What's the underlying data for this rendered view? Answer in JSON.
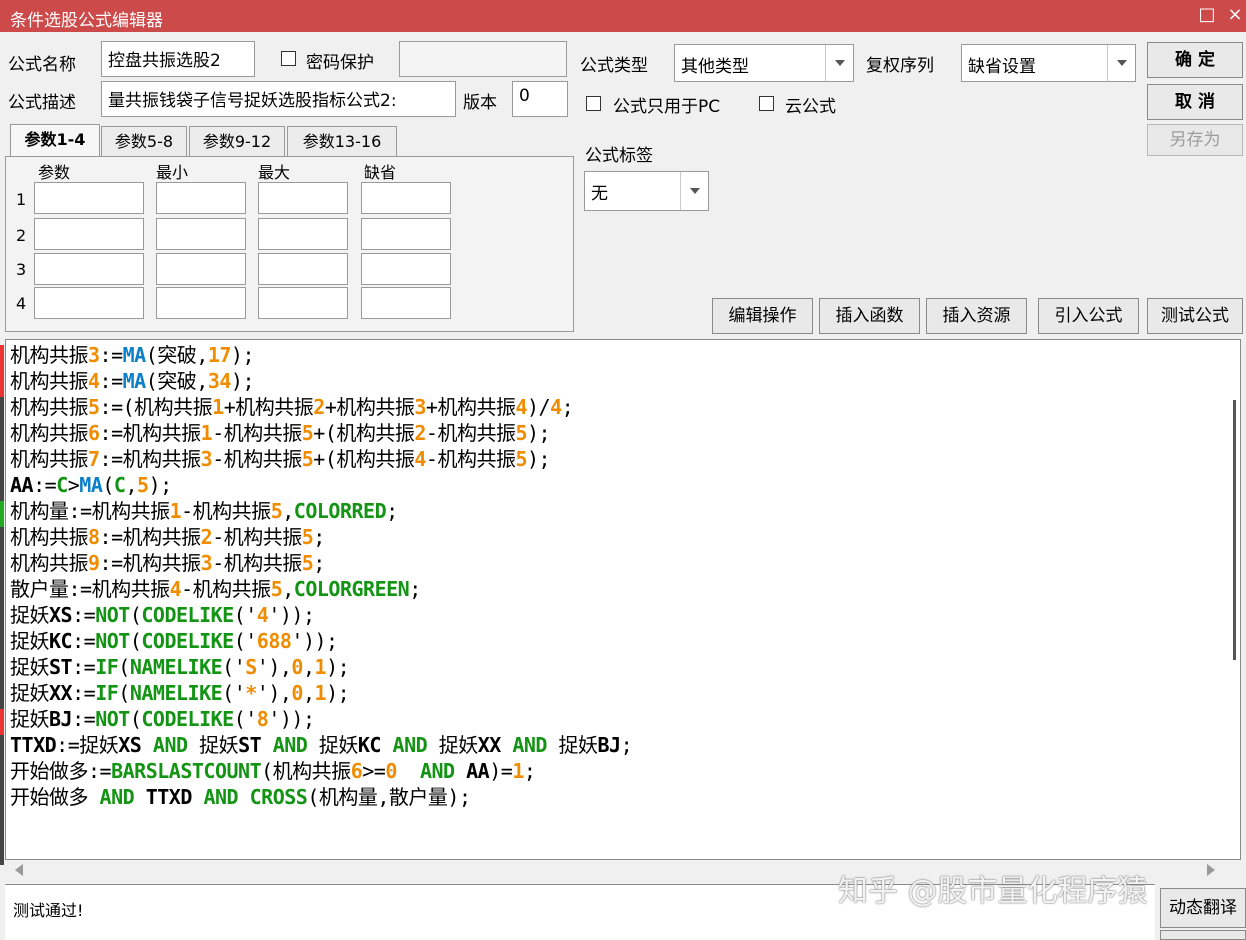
{
  "window": {
    "title": "条件选股公式编辑器",
    "maximize_icon": "□",
    "close_icon": "×"
  },
  "form": {
    "name_label": "公式名称",
    "name_value": "控盘共振选股2",
    "password_label": "密码保护",
    "password_checked": false,
    "desc_label": "公式描述",
    "desc_value": "量共振钱袋子信号捉妖选股指标公式2:",
    "version_label": "版本",
    "version_value": "0",
    "type_label": "公式类型",
    "type_value": "其他类型",
    "rights_label": "复权序列",
    "rights_value": "缺省设置",
    "pc_only_label": "公式只用于PC",
    "pc_only_checked": false,
    "cloud_label": "云公式",
    "cloud_checked": false,
    "tag_label": "公式标签",
    "tag_value": "无"
  },
  "buttons": {
    "ok": "确 定",
    "cancel": "取 消",
    "save_as": "另存为",
    "edit_ops": "编辑操作",
    "insert_func": "插入函数",
    "insert_res": "插入资源",
    "import": "引入公式",
    "test": "测试公式",
    "dynamic_translate": "动态翻译"
  },
  "param_tabs": [
    "参数1-4",
    "参数5-8",
    "参数9-12",
    "参数13-16"
  ],
  "param_headers": [
    "参数",
    "最小",
    "最大",
    "缺省"
  ],
  "param_rows": [
    "1",
    "2",
    "3",
    "4"
  ],
  "code_lines": [
    "机构共振3:=MA(突破,17);",
    "机构共振4:=MA(突破,34);",
    "机构共振5:=(机构共振1+机构共振2+机构共振3+机构共振4)/4;",
    "机构共振6:=机构共振1-机构共振5+(机构共振2-机构共振5);",
    "机构共振7:=机构共振3-机构共振5+(机构共振4-机构共振5);",
    "AA:=C>MA(C,5);",
    "机构量:=机构共振1-机构共振5,COLORRED;",
    "机构共振8:=机构共振2-机构共振5;",
    "机构共振9:=机构共振3-机构共振5;",
    "散户量:=机构共振4-机构共振5,COLORGREEN;",
    "捉妖XS:=NOT(CODELIKE('4'));",
    "捉妖KC:=NOT(CODELIKE('688'));",
    "捉妖ST:=IF(NAMELIKE('S'),0,1);",
    "捉妖XX:=IF(NAMELIKE('*'),0,1);",
    "捉妖BJ:=NOT(CODELIKE('8'));",
    "TTXD:=捉妖XS AND 捉妖ST AND 捉妖KC AND 捉妖XX AND 捉妖BJ;",
    "开始做多:=BARSLASTCOUNT(机构共振6>=0  AND AA)=1;",
    "开始做多 AND TTXD AND CROSS(机构量,散户量);"
  ],
  "status_text": "测试通过!",
  "watermark": "知乎 @股市量化程序猿",
  "colors": {
    "titlebar": "#cd4a4a",
    "function": "#0b7fc8",
    "number": "#f08c00",
    "keyword": "#149414"
  }
}
